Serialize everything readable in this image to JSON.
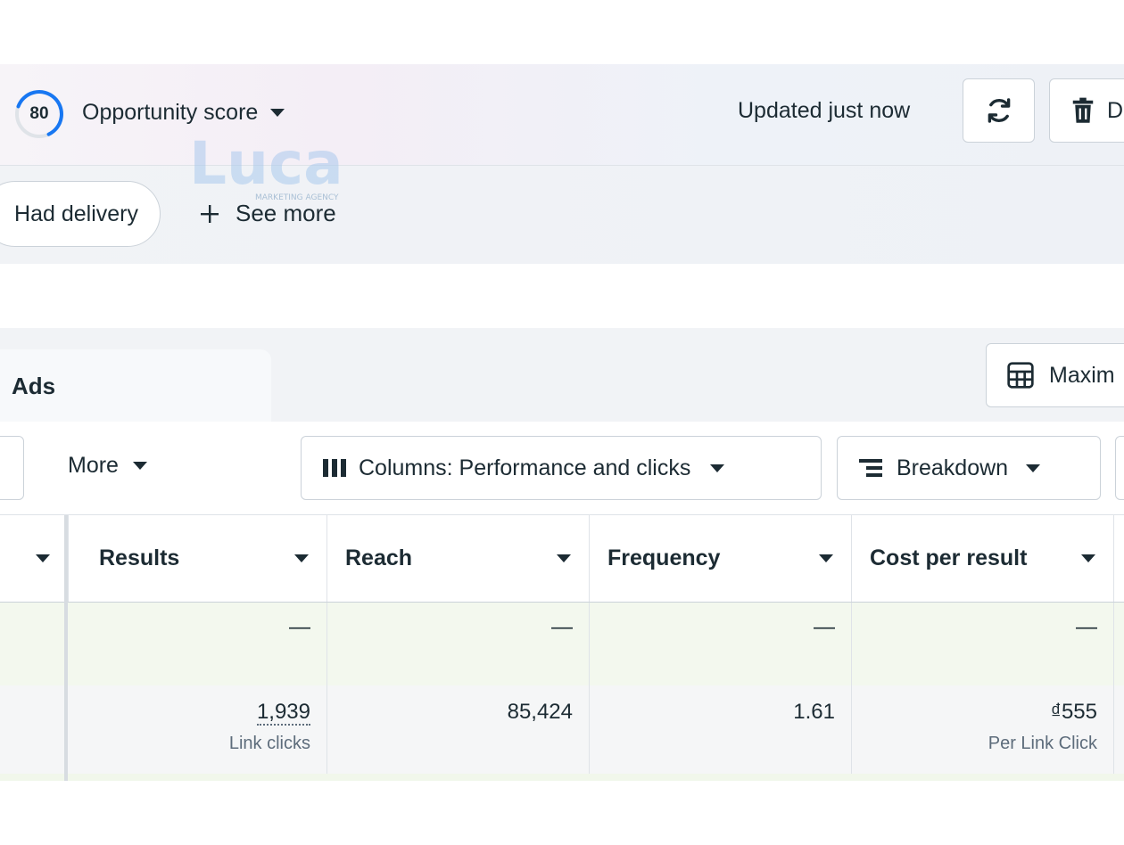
{
  "header": {
    "opportunity_score": "80",
    "opportunity_label": "Opportunity score",
    "updated_text": "Updated just now",
    "delete_partial": "D"
  },
  "filters": {
    "chip_label": "Had delivery",
    "see_more": "See more"
  },
  "watermark": {
    "brand": "Luca",
    "tagline": "MARKETING AGENCY"
  },
  "tabs": {
    "active": "Ads",
    "right_button_partial": "Maxim"
  },
  "toolbar": {
    "more_label": "More",
    "columns_label": "Columns: Performance and clicks",
    "breakdown_label": "Breakdown"
  },
  "table": {
    "columns": [
      "Results",
      "Reach",
      "Frequency",
      "Cost per result"
    ],
    "rows": [
      {
        "results": "—",
        "reach": "—",
        "frequency": "—",
        "cost_per_result": "—"
      },
      {
        "results": "1,939",
        "results_sub": "Link clicks",
        "reach": "85,424",
        "frequency": "1.61",
        "cost_per_result": "₫555",
        "cost_sub": "Per Link Click"
      }
    ]
  },
  "colors": {
    "accent_blue": "#0a78be",
    "text": "#1c2b33",
    "row_green": "#f3f8ee"
  }
}
